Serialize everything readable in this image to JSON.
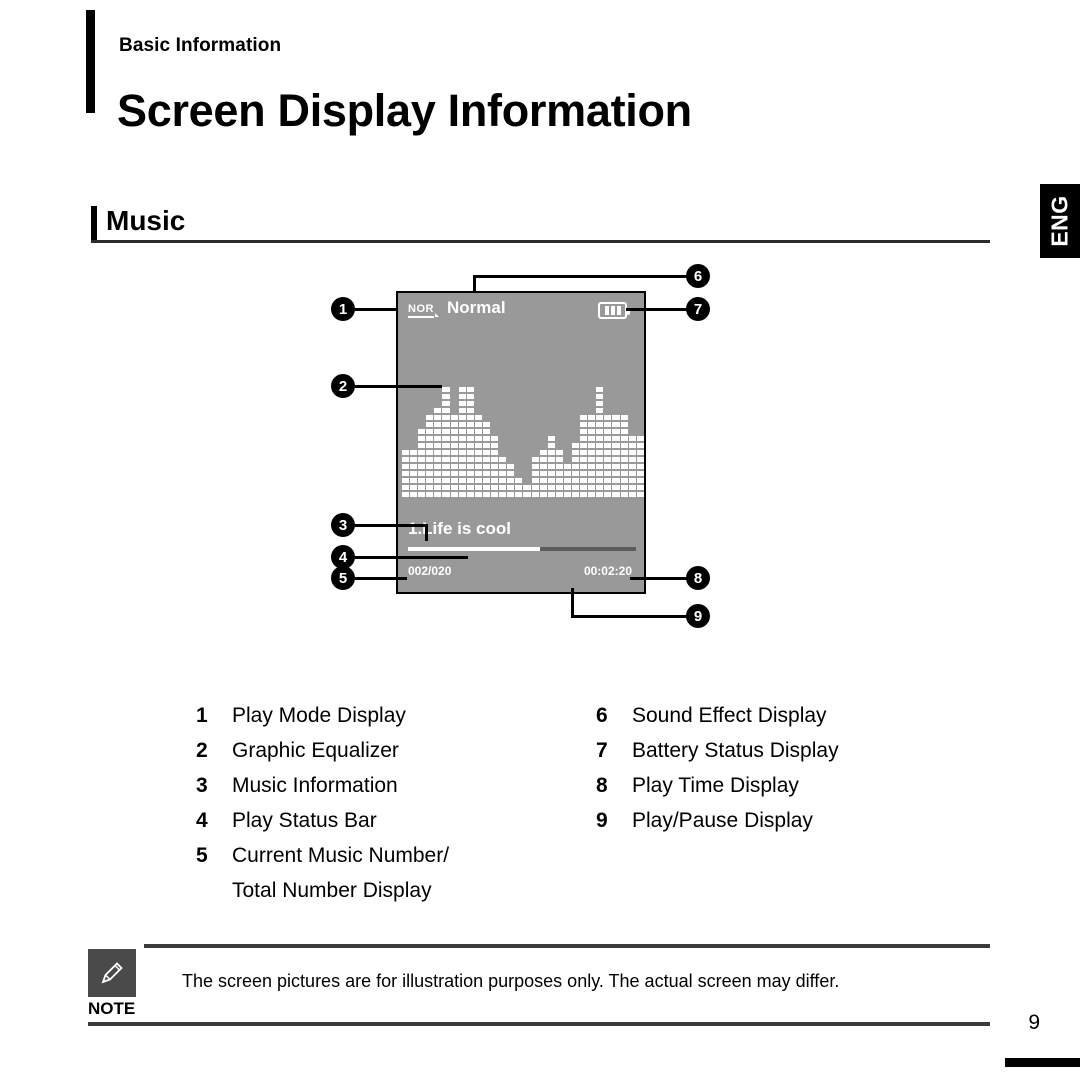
{
  "header": {
    "eyebrow": "Basic Information",
    "title": "Screen Display Information"
  },
  "side_tab": {
    "label": "ENG"
  },
  "section": {
    "title": "Music"
  },
  "device_screen": {
    "play_mode_icon": "nor-play-mode-icon",
    "play_mode_icon_label": "NOR",
    "sound_effect_label": "Normal",
    "battery_icon": "battery-icon",
    "battery_bars": 3,
    "track_title": "1.Life is cool",
    "track_index": "002/020",
    "play_time": "00:02:20",
    "progress_percent": 58,
    "equalizer_levels": [
      7,
      7,
      10,
      12,
      13,
      16,
      12,
      16,
      16,
      12,
      11,
      9,
      6,
      5,
      3,
      2,
      6,
      7,
      9,
      7,
      5,
      8,
      12,
      12,
      16,
      12,
      12,
      12,
      9,
      9
    ]
  },
  "callouts": [
    {
      "id": "1",
      "target": "play-mode-display"
    },
    {
      "id": "2",
      "target": "graphic-equalizer"
    },
    {
      "id": "3",
      "target": "music-information"
    },
    {
      "id": "4",
      "target": "play-status-bar"
    },
    {
      "id": "5",
      "target": "current-music-number"
    },
    {
      "id": "6",
      "target": "sound-effect-display"
    },
    {
      "id": "7",
      "target": "battery-status-display"
    },
    {
      "id": "8",
      "target": "play-time-display"
    },
    {
      "id": "9",
      "target": "play-pause-display"
    }
  ],
  "legend": {
    "left": [
      {
        "num": "1",
        "text": "Play Mode Display"
      },
      {
        "num": "2",
        "text": "Graphic Equalizer"
      },
      {
        "num": "3",
        "text": "Music Information"
      },
      {
        "num": "4",
        "text": "Play Status Bar"
      },
      {
        "num": "5",
        "text": "Current Music Number/"
      },
      {
        "num": "",
        "text": "Total Number Display"
      }
    ],
    "right": [
      {
        "num": "6",
        "text": "Sound Effect Display"
      },
      {
        "num": "7",
        "text": "Battery Status Display"
      },
      {
        "num": "8",
        "text": "Play Time Display"
      },
      {
        "num": "9",
        "text": "Play/Pause Display"
      }
    ]
  },
  "note": {
    "label": "NOTE",
    "icon": "pencil-icon",
    "text": "The screen pictures are for illustration purposes only. The actual screen may differ."
  },
  "footer": {
    "page_number": "9"
  }
}
